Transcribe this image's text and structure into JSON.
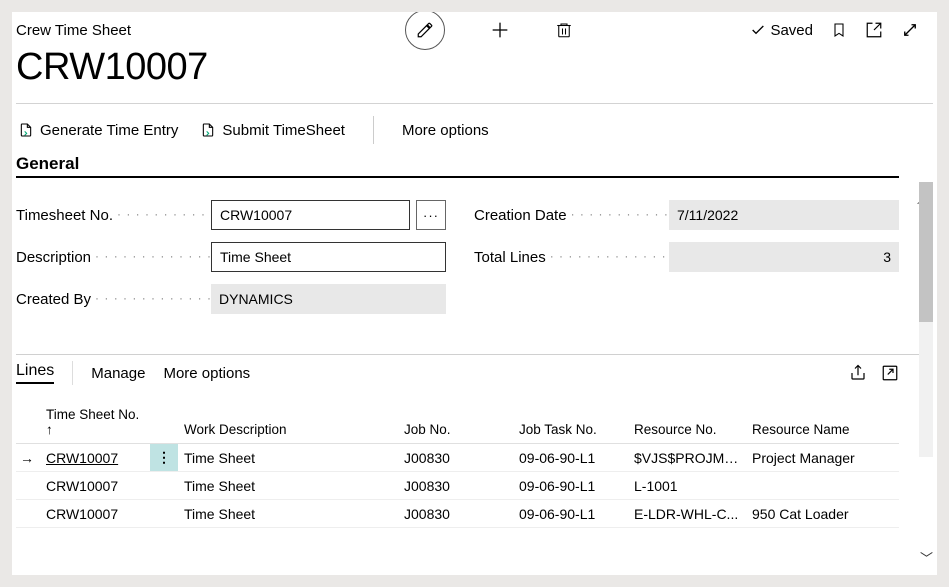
{
  "breadcrumb": "Crew Time Sheet",
  "title": "CRW10007",
  "saved_label": "Saved",
  "actions": {
    "generate": "Generate Time Entry",
    "submit": "Submit TimeSheet",
    "more": "More options"
  },
  "section_general": "General",
  "fields": {
    "timesheet_no_label": "Timesheet No.",
    "timesheet_no_value": "CRW10007",
    "description_label": "Description",
    "description_value": "Time Sheet",
    "created_by_label": "Created By",
    "created_by_value": "DYNAMICS",
    "creation_date_label": "Creation Date",
    "creation_date_value": "7/11/2022",
    "total_lines_label": "Total Lines",
    "total_lines_value": "3"
  },
  "lines": {
    "title": "Lines",
    "manage": "Manage",
    "more": "More options",
    "columns": {
      "timesheet_no": "Time Sheet No. ↑",
      "work_desc": "Work Description",
      "job_no": "Job No.",
      "job_task_no": "Job Task No.",
      "resource_no": "Resource No.",
      "resource_name": "Resource Name"
    },
    "rows": [
      {
        "no": "CRW10007",
        "desc": "Time Sheet",
        "job": "J00830",
        "task": "09-06-90-L1",
        "res": "$VJS$PROJMGR",
        "name": "Project Manager",
        "selected": true
      },
      {
        "no": "CRW10007",
        "desc": "Time Sheet",
        "job": "J00830",
        "task": "09-06-90-L1",
        "res": "L-1001",
        "name": "",
        "selected": false
      },
      {
        "no": "CRW10007",
        "desc": "Time Sheet",
        "job": "J00830",
        "task": "09-06-90-L1",
        "res": "E-LDR-WHL-C...",
        "name": "950 Cat Loader",
        "selected": false
      }
    ]
  }
}
